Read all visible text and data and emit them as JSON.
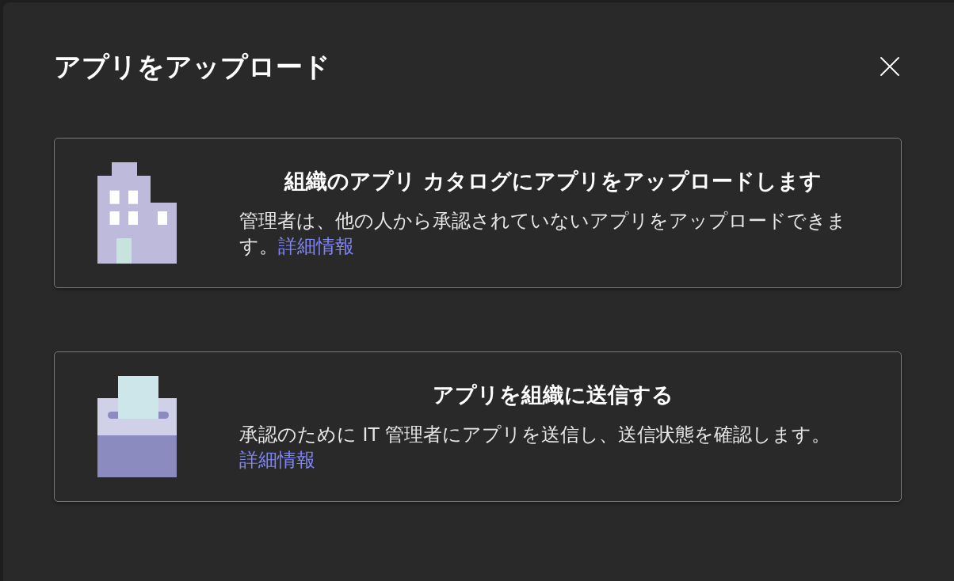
{
  "dialog": {
    "title": "アプリをアップロード",
    "options": [
      {
        "kind": "building",
        "title": "組織のアプリ カタログにアプリをアップロードします",
        "description": "管理者は、他の人から承認されていないアプリをアップロードできます。",
        "link": "詳細情報"
      },
      {
        "kind": "ballot_box",
        "title": "アプリを組織に送信する",
        "description": "承認のために IT 管理者にアプリを送信し、送信状態を確認します。 ",
        "link": "詳細情報"
      }
    ]
  }
}
